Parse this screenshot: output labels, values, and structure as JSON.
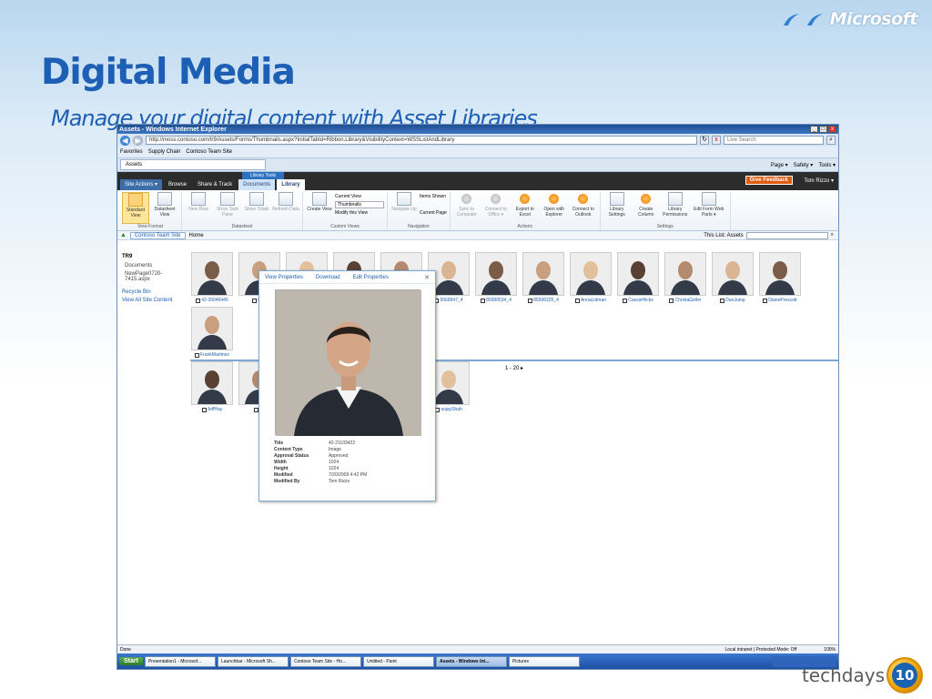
{
  "slide": {
    "logo": "Microsoft",
    "title": "Digital Media",
    "subtitle": "Manage your digital content with Asset Libraries",
    "footer": "techdays",
    "badge": "10"
  },
  "browser": {
    "window_title": "Assets - Windows Internet Explorer",
    "address": "http://moss.contoso.com/tr9/Assets/Forms/Thumbnails.aspx?InitialTabId=Ribbon.Library&VisibilityContext=WSSListAndLibrary",
    "search_placeholder": "Live Search",
    "favorites": "Favorites",
    "supply_chain": "Supply Chain",
    "contoso_team": "Contoso Team Site",
    "tab_label": "Assets",
    "page_menu": "Page ▾",
    "safety_menu": "Safety ▾",
    "tools_menu": "Tools ▾"
  },
  "sharepoint": {
    "library_tools": "Library Tools",
    "tabs": {
      "site_actions": "Site Actions ▾",
      "browse": "Browse",
      "share_track": "Share & Track",
      "documents": "Documents",
      "library": "Library"
    },
    "give_feedback": "Give Feedback",
    "user": "Tom Rizzo ▾",
    "ribbon": {
      "standard_view": "Standard View",
      "datasheet_view": "Datasheet View",
      "view_format": "View Format",
      "new_row": "New Row",
      "show_task_pane": "Show Task Pane",
      "show_totals": "Show Totals",
      "refresh_data": "Refresh Data",
      "datasheet": "Datasheet",
      "create_view": "Create View",
      "current_view": "Current View",
      "view_select": "Thumbnails",
      "modify_view": "Modify this View",
      "custom_views": "Custom Views",
      "navigate_up": "Navigate Up",
      "items_shown": "Items Shown",
      "current_page": "Current Page",
      "navigation": "Navigation",
      "sync": "Sync to Computer",
      "connect_office": "Connect to Office ▾",
      "export_excel": "Export to Excel",
      "open_explorer": "Open with Explorer",
      "connect_outlook": "Connect to Outlook",
      "actions": "Actions",
      "library_settings": "Library Settings",
      "create_column": "Create Column",
      "library_permissions": "Library Permissions",
      "edit_form": "Edit Form Web Parts ▾",
      "settings": "Settings"
    },
    "breadcrumb": {
      "site": "Contoso Team Site",
      "home": "Home"
    },
    "search_scope": "This List: Assets",
    "left_nav": {
      "heading": "TR9",
      "items": [
        "Documents",
        "NewPage0720-7415.aspx"
      ],
      "recycle": "Recycle Bin",
      "all_content": "View All Site Content"
    },
    "row1": [
      "42-20046445",
      "42-2",
      "",
      "",
      "",
      "5568947_4",
      "85580534_4",
      "85596225_4",
      "AnnaLidman",
      "CassieHicks",
      "ChristaGeller",
      "DanJump",
      "DianePrescott",
      "FrankMartinez"
    ],
    "row2": [
      "JeffHay",
      "Je",
      "",
      "",
      "",
      "anjayShah"
    ],
    "paging": "1 - 20 ▸",
    "popup": {
      "view_properties": "View Properties",
      "download": "Download",
      "edit_properties": "Edit Properties",
      "close": "✕",
      "props": [
        {
          "k": "Title",
          "v": "42-21103422"
        },
        {
          "k": "Content Type",
          "v": "Image"
        },
        {
          "k": "Approval Status",
          "v": "Approved"
        },
        {
          "k": "Width",
          "v": "1024"
        },
        {
          "k": "Height",
          "v": "1024"
        },
        {
          "k": "Modified",
          "v": "7/20/2009 4:42 PM"
        },
        {
          "k": "Modified By",
          "v": "Tom Rizzo"
        }
      ]
    }
  },
  "status": {
    "left": "Done",
    "zone": "Local intranet | Protected Mode: Off",
    "zoom": "100%"
  },
  "taskbar": {
    "start": "Start",
    "items": [
      "Presentation1 - Microsof...",
      "Launchbar - Microsoft Sh...",
      "Contoso Team Site - Ho...",
      "Untitled - Paint",
      "Assets - Windows Int...",
      "Pictures"
    ]
  }
}
